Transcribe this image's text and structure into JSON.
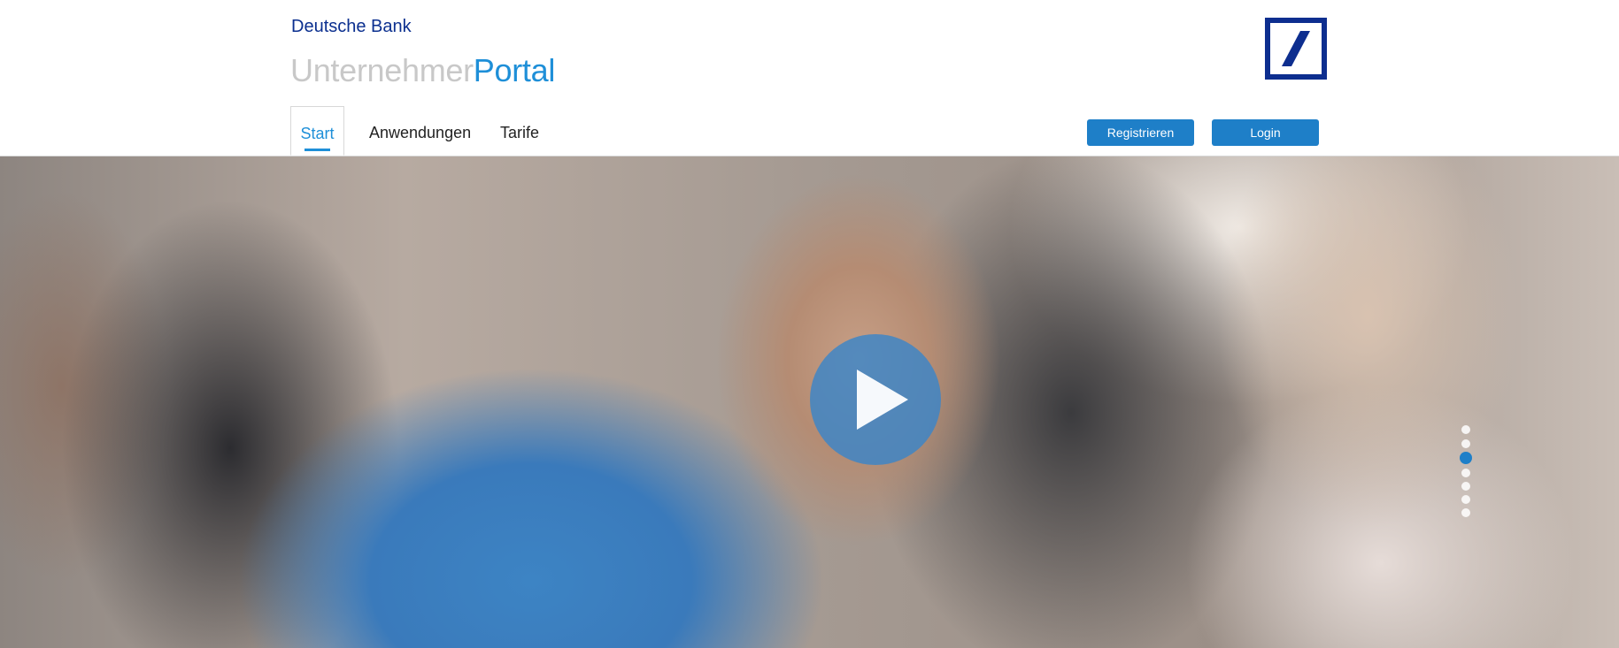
{
  "header": {
    "brand": "Deutsche Bank",
    "portal_part1": "Unternehmer",
    "portal_part2": "Portal",
    "logo_icon": "deutsche-bank-logo"
  },
  "nav": {
    "items": [
      {
        "label": "Start",
        "active": true
      },
      {
        "label": "Anwendungen",
        "active": false
      },
      {
        "label": "Tarife",
        "active": false
      }
    ]
  },
  "actions": {
    "register_label": "Registrieren",
    "login_label": "Login"
  },
  "hero": {
    "play_icon": "play-icon",
    "slide_count": 7,
    "active_slide": 3
  },
  "colors": {
    "brand_blue": "#0d2e8f",
    "accent_blue": "#1e8fd8",
    "button_blue": "#1e7fc8",
    "portal_gray": "#c8c8c8"
  }
}
